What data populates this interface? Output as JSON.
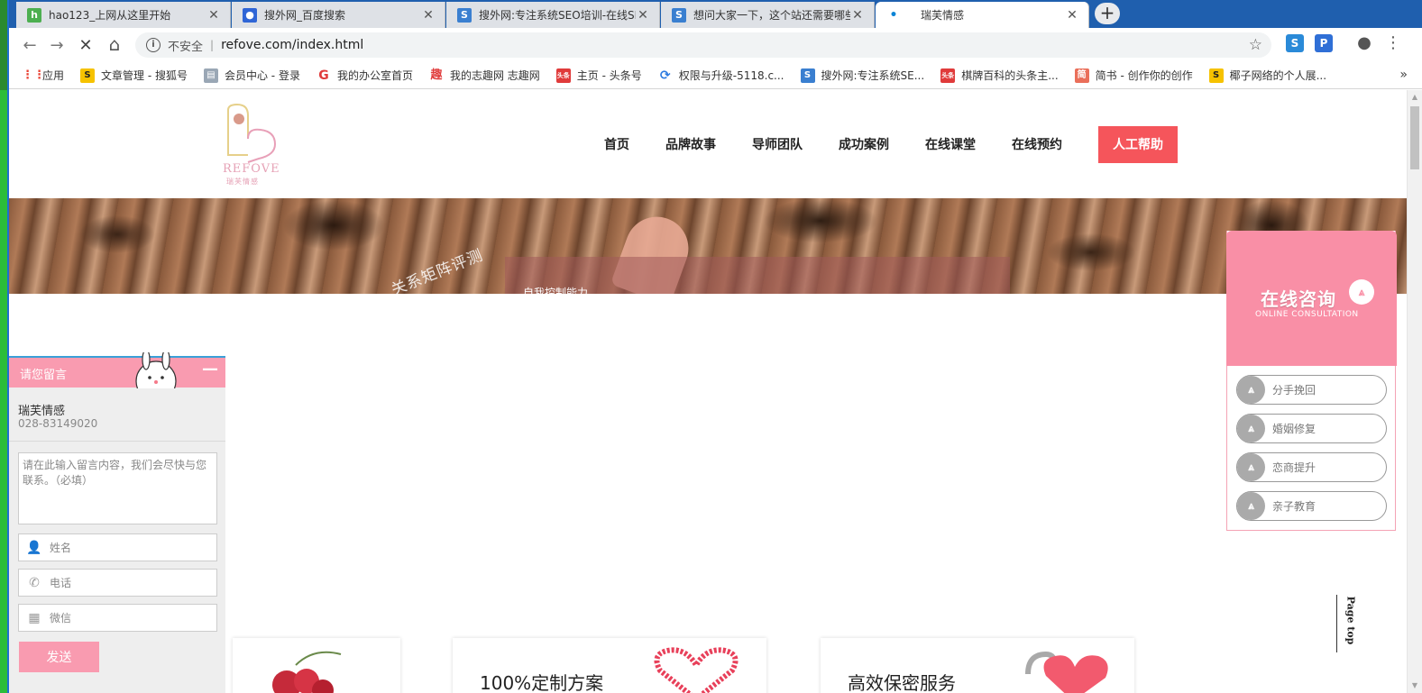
{
  "browser": {
    "tabs": [
      {
        "title": "hao123_上网从这里开始",
        "favicon": "hao123-icon",
        "color": "#4caf50"
      },
      {
        "title": "搜外网_百度搜索",
        "favicon": "baidu-paw-icon",
        "color": "#2f65d6"
      },
      {
        "title": "搜外网:专注系统SEO培训-在线SE",
        "favicon": "s-icon",
        "color": "#3a7fd0"
      },
      {
        "title": "想问大家一下，这个站还需要哪些",
        "favicon": "s-icon",
        "color": "#3a7fd0"
      },
      {
        "title": "瑞芙情感",
        "favicon": "loading-icon",
        "color": "#0a84d6"
      }
    ],
    "address": {
      "security_label": "不安全",
      "url": "refove.com/index.html"
    },
    "bookmarks": [
      {
        "label": "应用",
        "color": "#ea4335"
      },
      {
        "label": "文章管理 - 搜狐号",
        "color": "#f6c200"
      },
      {
        "label": "会员中心 - 登录",
        "color": "#9aa7b5"
      },
      {
        "label": "我的办公室首页",
        "color": "#e03b3b"
      },
      {
        "label": "我的志趣网 志趣网",
        "color": "#e03b3b"
      },
      {
        "label": "主页 - 头条号",
        "color": "#e03b3b"
      },
      {
        "label": "权限与升级-5118.c...",
        "color": "#2d7be0"
      },
      {
        "label": "搜外网:专注系统SE...",
        "color": "#3a7fd0"
      },
      {
        "label": "棋牌百科的头条主...",
        "color": "#e03b3b"
      },
      {
        "label": "简书 - 创作你的创作",
        "color": "#ea6f5a"
      },
      {
        "label": "椰子网络的个人展...",
        "color": "#f6c200"
      }
    ]
  },
  "site": {
    "logo": {
      "en": "REFOVE",
      "cn": "瑞芙情感"
    },
    "nav": [
      "首页",
      "品牌故事",
      "导师团队",
      "成功案例",
      "在线课堂",
      "在线预约"
    ],
    "cta": "人工帮助",
    "banner": {
      "stamp": "关系矩阵评测",
      "sub": "自我控制能力"
    },
    "features": [
      "100%定制方案",
      "高效保密服务"
    ],
    "chat": {
      "title": "请您留言",
      "company": "瑞芙情感",
      "phone": "028-83149020",
      "message_placeholder": "请在此输入留言内容，我们会尽快与您联系。（必填）",
      "name_placeholder": "姓名",
      "phone_placeholder": "电话",
      "wechat_placeholder": "微信",
      "send": "发送"
    },
    "consult": {
      "title": "在线咨询",
      "subtitle": "ONLINE CONSULTATION",
      "options": [
        "分手挽回",
        "婚姻修复",
        "恋商提升",
        "亲子教育"
      ]
    },
    "page_top": "Page top"
  }
}
